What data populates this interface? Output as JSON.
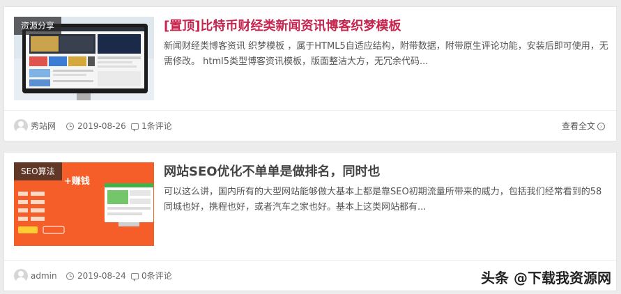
{
  "posts": [
    {
      "category": "资源分享",
      "title": "[置顶]比特币财经类新闻资讯博客织梦模板",
      "excerpt": "新闻财经类博客资讯 织梦模板 ，属于HTML5自适应结构，附带数据，附带原生评论功能，安装后即可使用，无需修改。 html5类型博客资讯模板，版面整洁大方，无冗余代码...",
      "author": "秀站网",
      "date": "2019-08-26",
      "comments": "1条评论",
      "read_more": "查看全文"
    },
    {
      "category": "SEO算法",
      "title": "网站SEO优化不单单是做排名，同时也",
      "excerpt": "可以这么讲，国内所有的大型网站能够做大基本上都是靠SEO初期流量所带来的威力，包括我们经常看到的58同城也好，携程也好，或者汽车之家也好。基本上这类网站都有...",
      "author": "admin",
      "date": "2019-08-24",
      "comments": "0条评论",
      "thumb_text": "+赚钱"
    }
  ],
  "watermark": "头条 @下载我资源网",
  "colors": {
    "pinned_title": "#c7254e",
    "thumb1_orange": "#f4511e"
  }
}
